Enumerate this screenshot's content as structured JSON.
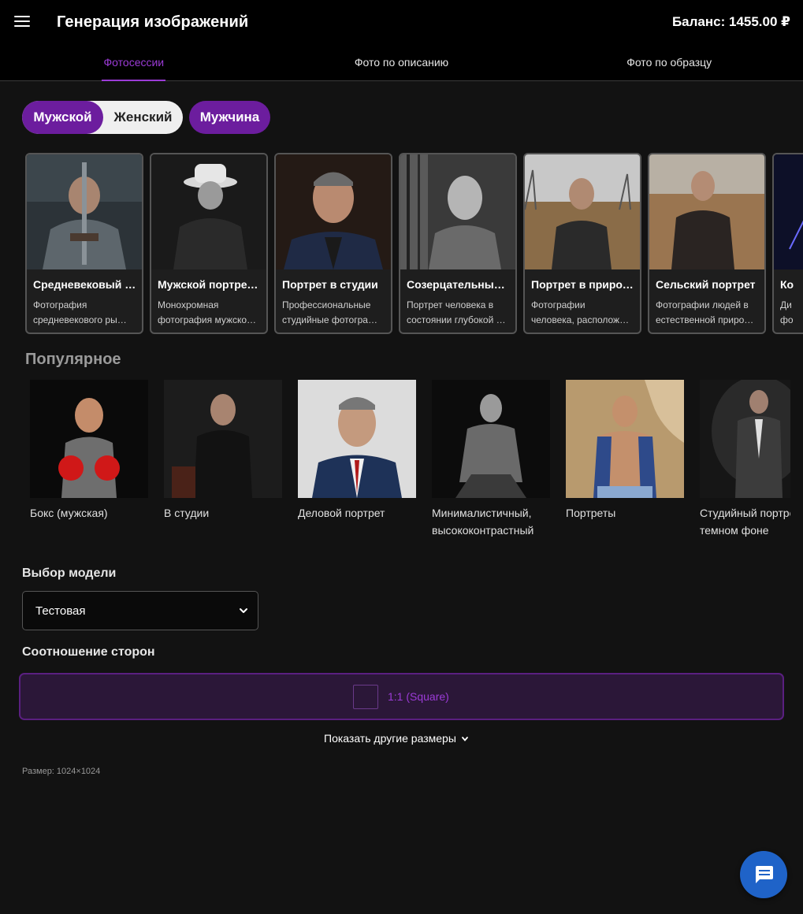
{
  "header": {
    "title": "Генерация изображений",
    "balance": "Баланс: 1455.00 ₽",
    "menu_icon": "hamburger-menu-icon"
  },
  "tabs": [
    {
      "label": "Фотосессии",
      "active": true
    },
    {
      "label": "Фото по описанию",
      "active": false
    },
    {
      "label": "Фото по образцу",
      "active": false
    }
  ],
  "gender_toggle": {
    "options": [
      "Мужской",
      "Женский"
    ],
    "selected": "Мужской"
  },
  "model_pill": "Мужчина",
  "sessions": [
    {
      "title": "Средневековый …",
      "desc1": "Фотография",
      "desc2": "средневекового ры…"
    },
    {
      "title": "Мужской портрет…",
      "desc1": "Монохромная",
      "desc2": "фотография мужско…"
    },
    {
      "title": "Портрет в студии",
      "desc1": "Профессиональные",
      "desc2": "студийные фотогра…"
    },
    {
      "title": "Созерцательный …",
      "desc1": "Портрет человека в",
      "desc2": "состоянии глубокой …"
    },
    {
      "title": "Портрет в природе",
      "desc1": "Фотографии",
      "desc2": "человека, располож…"
    },
    {
      "title": "Сельский портрет",
      "desc1": "Фотографии людей в",
      "desc2": "естественной приро…"
    },
    {
      "title": "Ко",
      "desc1": "Ди",
      "desc2": "фо"
    }
  ],
  "popular": {
    "title": "Популярное",
    "items": [
      {
        "label": "Бокс (мужская)"
      },
      {
        "label": "В студии"
      },
      {
        "label": "Деловой портрет"
      },
      {
        "label": "Минималистичный, высококонтрастный"
      },
      {
        "label": "Портреты"
      },
      {
        "label": "Студийный портрет на темном фоне"
      }
    ]
  },
  "model_select": {
    "label": "Выбор модели",
    "value": "Тестовая"
  },
  "aspect": {
    "label": "Соотношение сторон",
    "selected": "1:1 (Square)",
    "more": "Показать другие размеры",
    "size": "Размер: 1024×1024"
  },
  "colors": {
    "accent": "#9b3bd6",
    "pill": "#6c1d9e",
    "chat": "#1f63c8"
  }
}
